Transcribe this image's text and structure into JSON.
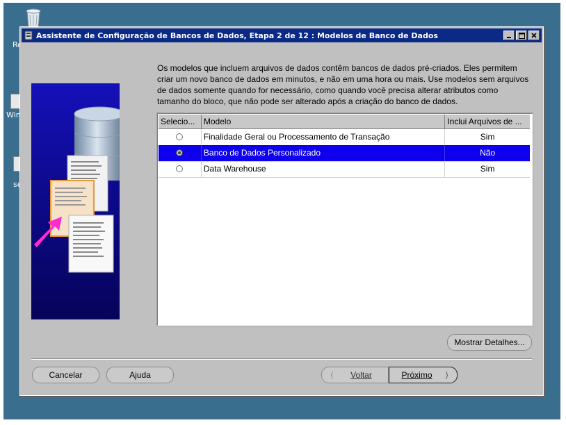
{
  "desktop": {
    "icon_labels": [
      "Re",
      "WinT",
      "se"
    ]
  },
  "window": {
    "title": "Assistente de Configuração de Bancos de Dados, Etapa 2 de 12 : Modelos de Banco de Dados",
    "minimize_label": "_",
    "maximize_label": "□",
    "close_label": "×"
  },
  "description": "Os modelos que incluem arquivos de dados contêm bancos de dados pré-criados. Eles permitem criar um novo banco de dados em minutos, e não em uma hora ou mais. Use modelos sem arquivos de dados somente quando for necessário, como quando você precisa alterar atributos como tamanho do bloco, que não pode ser alterado após a criação do banco de dados.",
  "table": {
    "columns": [
      "Selecio...",
      "Modelo",
      "Inclui Arquivos de ..."
    ],
    "rows": [
      {
        "selected": false,
        "model": "Finalidade Geral ou Processamento de Transação",
        "includes_files": "Sim"
      },
      {
        "selected": true,
        "model": "Banco de Dados Personalizado",
        "includes_files": "Não"
      },
      {
        "selected": false,
        "model": "Data Warehouse",
        "includes_files": "Sim"
      }
    ]
  },
  "buttons": {
    "show_details": "Mostrar Detalhes...",
    "cancel": "Cancelar",
    "help": "Ajuda",
    "back": "Voltar",
    "next": "Próximo"
  },
  "colors": {
    "title_bar": "#0a2a86",
    "selection": "#0e00ec",
    "window_bg": "#c0c0c0",
    "desktop": "#3a6e8f"
  }
}
